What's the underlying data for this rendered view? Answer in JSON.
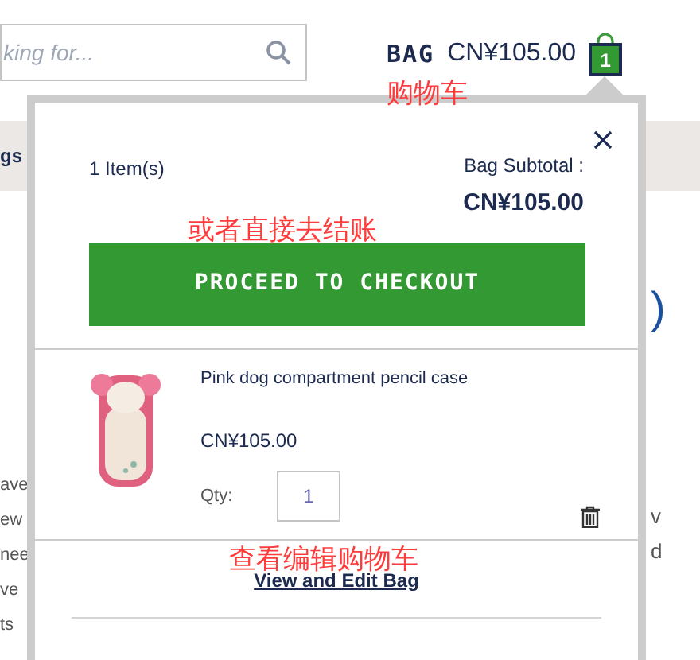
{
  "search": {
    "placeholder": "king for..."
  },
  "background": {
    "band_label": "gs",
    "left_fragments": [
      "ave",
      "ew",
      "nee",
      "ve",
      "ts"
    ],
    "right_fragments": [
      ")",
      "v",
      "d"
    ]
  },
  "header_bag": {
    "label": "BAG",
    "total": "CN¥105.00",
    "count": "1"
  },
  "annotations": [
    {
      "text": "购物车"
    },
    {
      "text": "或者直接去结账"
    },
    {
      "text": "查看编辑购物车"
    }
  ],
  "mini_bag": {
    "item_count": "1 Item(s)",
    "subtotal_label": "Bag Subtotal :",
    "subtotal": "CN¥105.00",
    "checkout_button": "PROCEED TO CHECKOUT",
    "items": [
      {
        "name": "Pink dog compartment pencil case",
        "price": "CN¥105.00",
        "qty_label": "Qty:",
        "qty": "1"
      }
    ],
    "view_edit_link": "View and Edit Bag"
  }
}
